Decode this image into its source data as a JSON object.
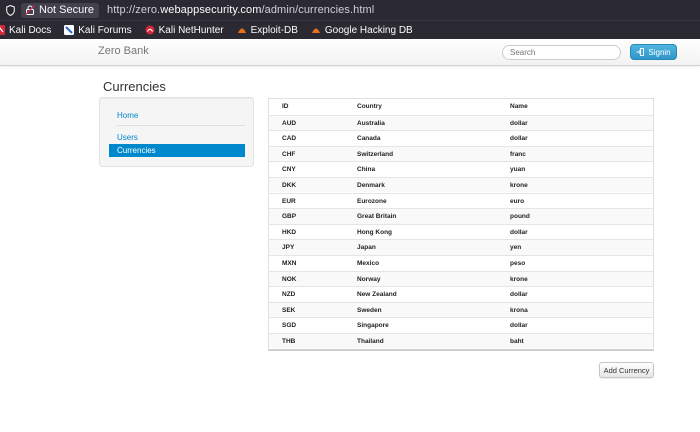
{
  "browser": {
    "security_label": "Not Secure",
    "url_prefix": "http://zero.",
    "url_domain": "webappsecurity.com",
    "url_path": "/admin/currencies.html",
    "bookmarks": [
      {
        "label": "Kali Docs",
        "icon": "kali-red-icon"
      },
      {
        "label": "Kali Forums",
        "icon": "kali-blue-icon"
      },
      {
        "label": "Kali NetHunter",
        "icon": "kali-red-icon"
      },
      {
        "label": "Exploit-DB",
        "icon": "exploit-db-icon"
      },
      {
        "label": "Google Hacking DB",
        "icon": "ghdb-icon"
      }
    ]
  },
  "app": {
    "brand": "Zero Bank",
    "search_placeholder": "Search",
    "signin_label": "Signin",
    "page_title": "Currencies"
  },
  "sidebar": {
    "items": [
      {
        "label": "Home",
        "active": false
      },
      {
        "label": "Users",
        "active": false
      },
      {
        "label": "Currencies",
        "active": true
      }
    ]
  },
  "table": {
    "headers": [
      "ID",
      "Country",
      "Name"
    ],
    "rows": [
      [
        "AUD",
        "Australia",
        "dollar"
      ],
      [
        "CAD",
        "Canada",
        "dollar"
      ],
      [
        "CHF",
        "Switzerland",
        "franc"
      ],
      [
        "CNY",
        "China",
        "yuan"
      ],
      [
        "DKK",
        "Denmark",
        "krone"
      ],
      [
        "EUR",
        "Eurozone",
        "euro"
      ],
      [
        "GBP",
        "Great Britain",
        "pound"
      ],
      [
        "HKD",
        "Hong Kong",
        "dollar"
      ],
      [
        "JPY",
        "Japan",
        "yen"
      ],
      [
        "MXN",
        "Mexico",
        "peso"
      ],
      [
        "NOK",
        "Norway",
        "krone"
      ],
      [
        "NZD",
        "New Zealand",
        "dollar"
      ],
      [
        "SEK",
        "Sweden",
        "krona"
      ],
      [
        "SGD",
        "Singapore",
        "dollar"
      ],
      [
        "THB",
        "Thailand",
        "baht"
      ]
    ]
  },
  "add_button_label": "Add Currency",
  "colors": {
    "accent": "#0088cc",
    "signin": "#2f96c9",
    "chrome": "#2b2a33"
  }
}
